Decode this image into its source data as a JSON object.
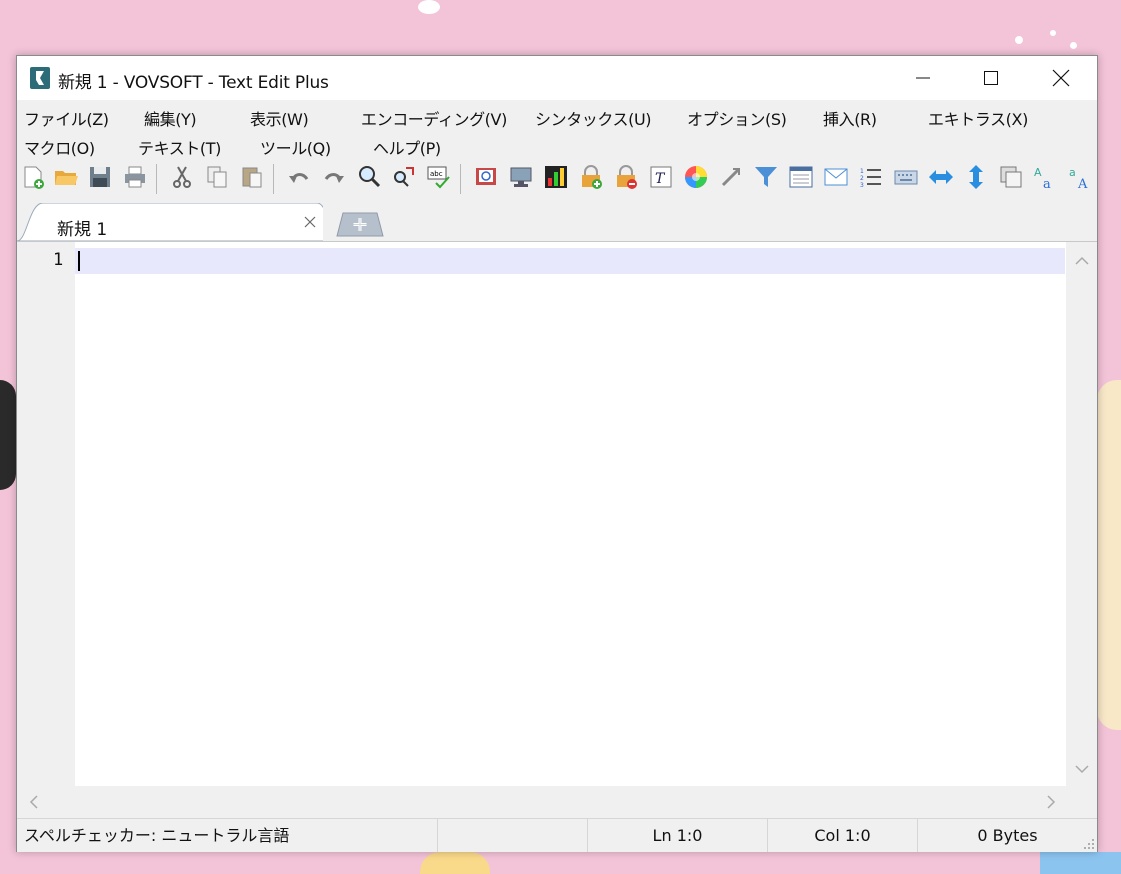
{
  "window": {
    "title": "新規 1 - VOVSOFT - Text Edit Plus"
  },
  "menu": [
    "ファイル(Z)",
    "編集(Y)",
    "表示(W)",
    "エンコーディング(V)",
    "シンタックス(U)",
    "オプション(S)",
    "挿入(R)",
    "エキトラス(X)",
    "マクロ(O)",
    "テキスト(T)",
    "ツール(Q)",
    "ヘルプ(P)"
  ],
  "toolbar_icons": [
    "new-file-icon",
    "open-folder-icon",
    "save-icon",
    "print-icon",
    "cut-icon",
    "copy-icon",
    "paste-icon",
    "undo-icon",
    "redo-icon",
    "find-icon",
    "replace-icon",
    "spellcheck-icon",
    "book-icon",
    "monitor-icon",
    "chart-icon",
    "lock-add-icon",
    "lock-remove-icon",
    "font-icon",
    "color-wheel-icon",
    "link-icon",
    "filter-icon",
    "window-icon",
    "mail-icon",
    "list-icon",
    "keyboard-icon",
    "horizontal-arrows-icon",
    "vertical-arrows-icon",
    "duplicate-icon",
    "translate-icon",
    "translate-alt-icon"
  ],
  "tabs": [
    {
      "label": "新規 1"
    }
  ],
  "editor": {
    "line_number": "1"
  },
  "status": {
    "spellcheck": "スペルチェッカー: ニュートラル言語",
    "empty": "",
    "line": "Ln 1:0",
    "col": "Col 1:0",
    "size": "0 Bytes"
  },
  "colors": {
    "current_line": "#e8e8fc",
    "title_bg": "#ffffff",
    "chrome": "#f0f0f0"
  }
}
